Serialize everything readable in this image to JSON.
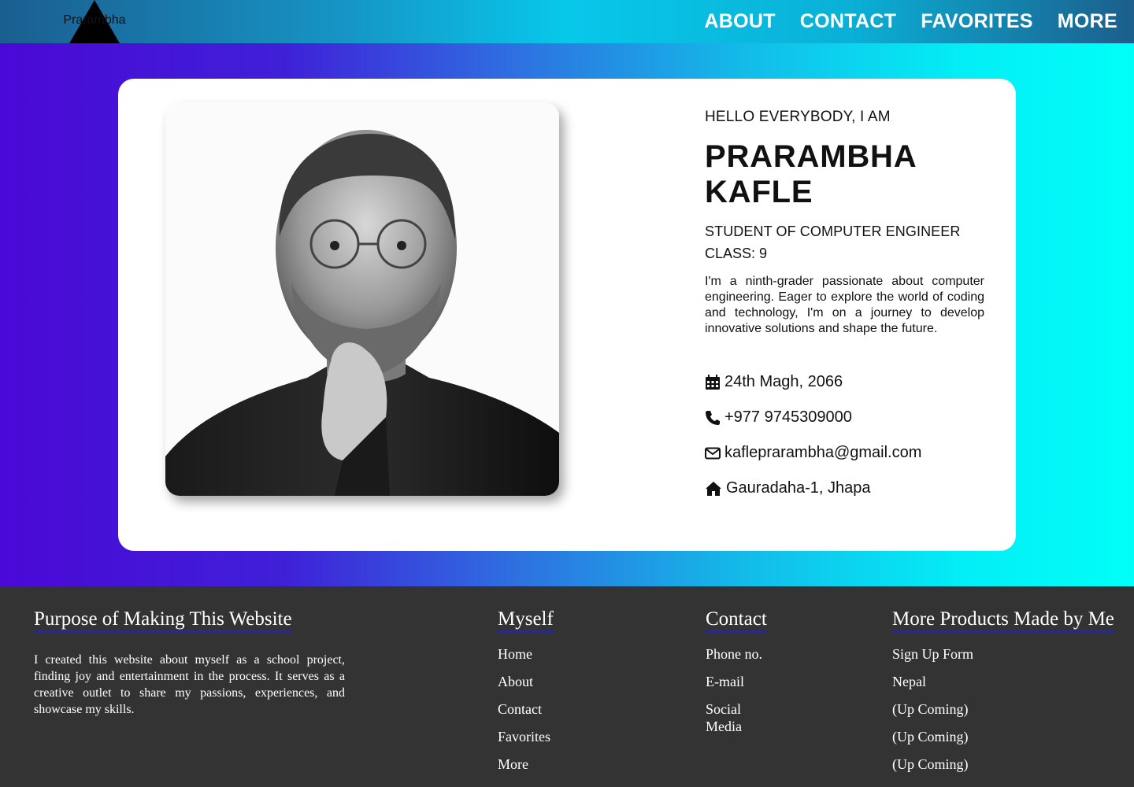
{
  "header": {
    "logo_text": "Prarambha",
    "nav": [
      "ABOUT",
      "CONTACT",
      "FAVORITES",
      "MORE"
    ]
  },
  "profile": {
    "greeting": "HELLO EVERYBODY, I AM",
    "name_line1": "PRARAMBHA",
    "name_line2": "KAFLE",
    "role": "STUDENT OF COMPUTER ENGINEER",
    "class": "CLASS: 9",
    "bio": "I'm a ninth-grader passionate about computer engineering. Eager to explore the world of coding and technology, I'm on a journey to develop innovative solutions and shape the future.",
    "details": [
      {
        "icon": "calendar-icon",
        "text": "24th Magh, 2066"
      },
      {
        "icon": "phone-icon",
        "text": "+977 9745309000"
      },
      {
        "icon": "envelope-icon",
        "text": "kafleprarambha@gmail.com"
      },
      {
        "icon": "home-icon",
        "text": "Gauradaha-1, Jhapa"
      }
    ]
  },
  "footer": {
    "purpose": {
      "title": "Purpose of Making This Website",
      "text": "I created this website about myself as a school project, finding joy and entertainment in the process. It serves as a creative outlet to share my passions, experiences, and showcase my skills."
    },
    "myself": {
      "title": "Myself",
      "links": [
        "Home",
        "About",
        "Contact",
        "Favorites",
        "More"
      ]
    },
    "contact": {
      "title": "Contact",
      "links": [
        "Phone no.",
        "E-mail",
        "Social Media"
      ]
    },
    "products": {
      "title": "More Products Made by Me",
      "links": [
        "Sign Up Form",
        "Nepal",
        "(Up Coming)",
        "(Up Coming)",
        "(Up Coming)"
      ]
    }
  },
  "colors": {
    "header_accent": "#08c8ea",
    "hero_left": "#4a08d6",
    "hero_right": "#00fff8",
    "footer_bg": "#333333",
    "footer_underline": "#2020d0"
  }
}
